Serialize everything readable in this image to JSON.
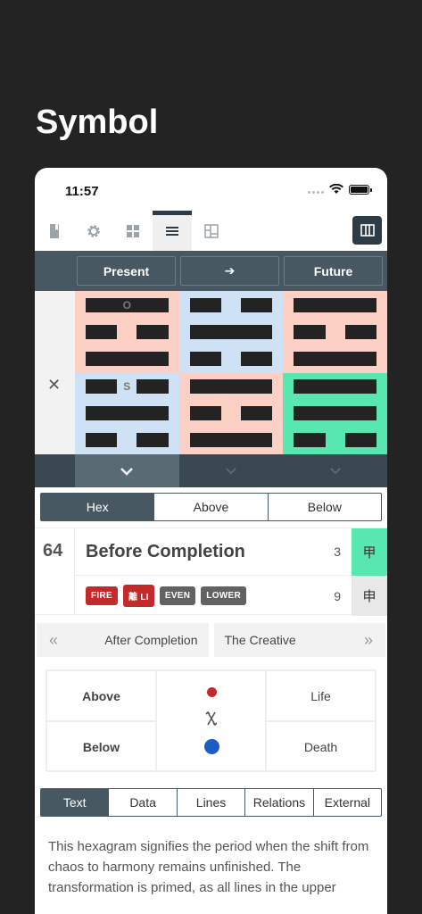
{
  "page_heading": "Symbol",
  "status_bar": {
    "time": "11:57"
  },
  "toolbar": {
    "icons": [
      "book-icon",
      "gear-icon",
      "grid-icon",
      "list-icon",
      "layout-icon"
    ],
    "active_index": 3,
    "right_icon": "columns-icon"
  },
  "header": {
    "present": "Present",
    "arrow": "➔",
    "future": "Future"
  },
  "grid": {
    "markers": {
      "o": "O",
      "s": "S"
    },
    "close_symbol": "✕"
  },
  "segments": {
    "items": [
      "Hex",
      "Above",
      "Below"
    ],
    "active": 0
  },
  "hexagram": {
    "number": "64",
    "title": "Before Completion",
    "upper_num": "3",
    "lower_num": "9",
    "upper_stem": "甲",
    "lower_stem": "申",
    "tags": [
      "FIRE",
      "離 LI",
      "EVEN",
      "LOWER"
    ]
  },
  "nav": {
    "prev": "After Completion",
    "next": "The Creative",
    "prev_chevron": "«",
    "next_chevron": "»"
  },
  "yinyang": {
    "above": "Above",
    "below": "Below",
    "life": "Life",
    "death": "Death"
  },
  "tabs": {
    "items": [
      "Text",
      "Data",
      "Lines",
      "Relations",
      "External"
    ],
    "active": 0
  },
  "body_text": "This hexagram signifies the period when the shift from chaos to harmony remains unfinished. The transformation is primed, as all lines in the upper",
  "colors": {
    "fire_red": "#c52a2a",
    "teal": "#58e6b1",
    "pink": "#fdd0c6",
    "blue": "#cfe2f5",
    "navy": "#485862"
  }
}
